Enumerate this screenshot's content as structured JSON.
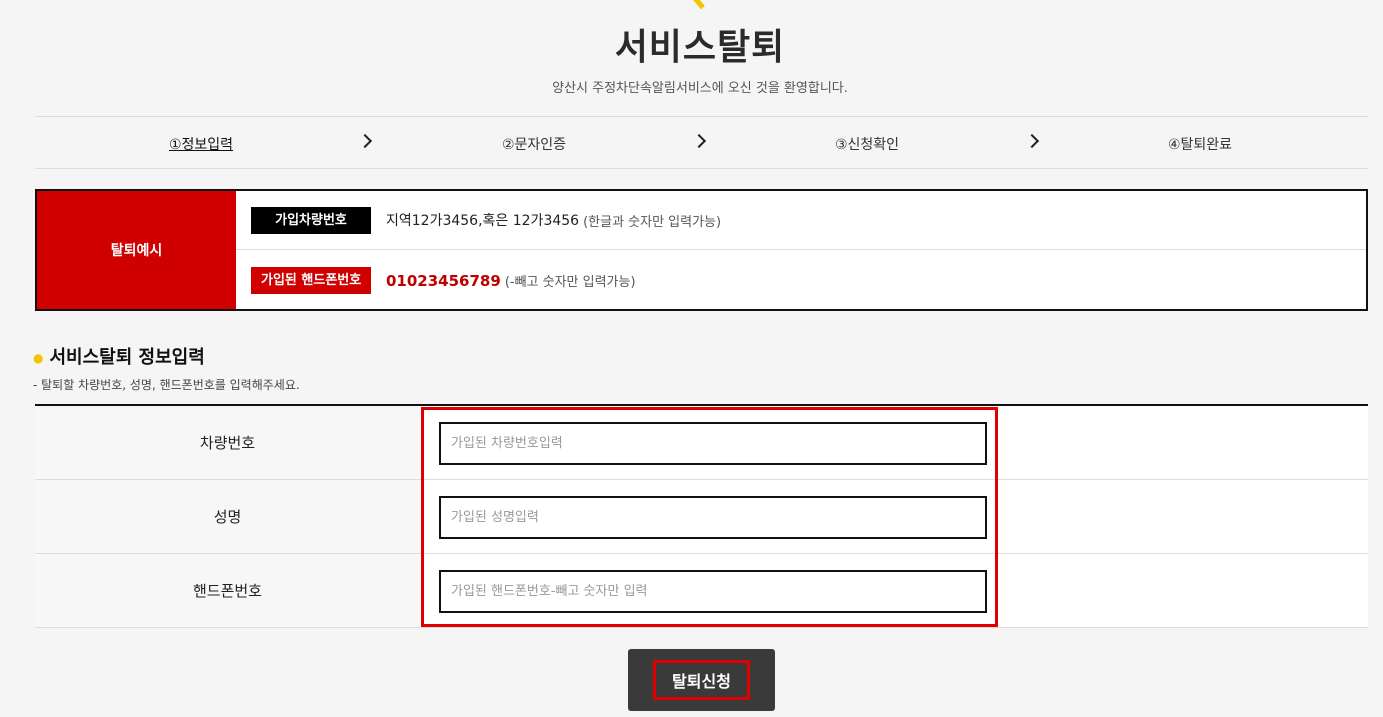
{
  "page": {
    "title": "서비스탈퇴",
    "subtitle": "양산시 주정차단속알림서비스에 오신 것을 환영합니다."
  },
  "steps": [
    {
      "label": "①정보입력"
    },
    {
      "label": "②문자인증"
    },
    {
      "label": "③신청확인"
    },
    {
      "label": "④탈퇴완료"
    }
  ],
  "example": {
    "heading": "탈퇴예시",
    "car": {
      "tag": "가입차량번호",
      "value": "지역12가3456,혹은 12가3456",
      "note": "(한글과 숫자만 입력가능)"
    },
    "phone": {
      "tag": "가입된 핸드폰번호",
      "value": "01023456789",
      "note": "(-빼고 숫자만 입력가능)"
    }
  },
  "section": {
    "title": "서비스탈퇴 정보입력",
    "desc": "- 탈퇴할 차량번호, 성명, 핸드폰번호를 입력해주세요."
  },
  "form": {
    "car": {
      "label": "차량번호",
      "placeholder": "가입된 차량번호입력",
      "value": ""
    },
    "name": {
      "label": "성명",
      "placeholder": "가입된 성명입력",
      "value": ""
    },
    "phone": {
      "label": "핸드폰번호",
      "placeholder": "가입된 핸드폰번호-빼고 숫자만 입력",
      "value": ""
    }
  },
  "submit": {
    "label": "탈퇴신청"
  },
  "colors": {
    "accent_red": "#d00000",
    "accent_yellow": "#f5c400",
    "dark": "#3a3a3a"
  }
}
